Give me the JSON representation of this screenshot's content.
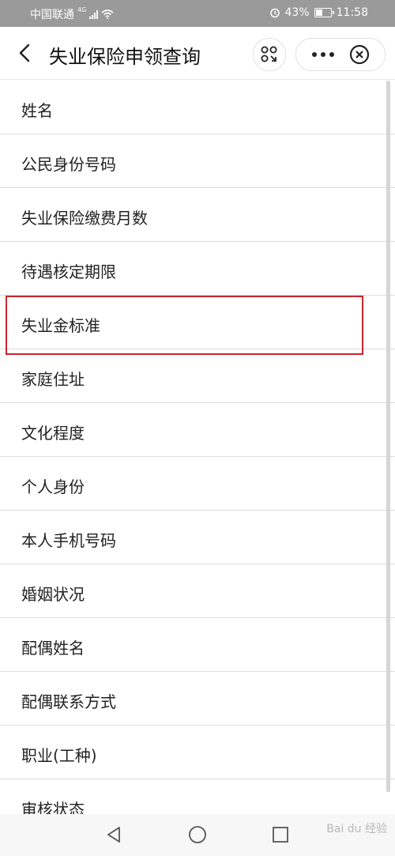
{
  "status_bar": {
    "carrier": "中国联通",
    "network": "4G",
    "battery": "43%",
    "time": "11:58"
  },
  "header": {
    "title": "失业保险申领查询"
  },
  "list": {
    "items": [
      "姓名",
      "公民身份号码",
      "失业保险缴费月数",
      "待遇核定期限",
      "失业金标准",
      "家庭住址",
      "文化程度",
      "个人身份",
      "本人手机号码",
      "婚姻状况",
      "配偶姓名",
      "配偶联系方式",
      "职业(工种)",
      "审核状态"
    ],
    "highlighted_index": 4
  },
  "watermark": "Bai du 经验",
  "colors": {
    "status_bar": "#9a9a9a",
    "highlight": "#c9252f",
    "divider": "#dcdcdc"
  }
}
